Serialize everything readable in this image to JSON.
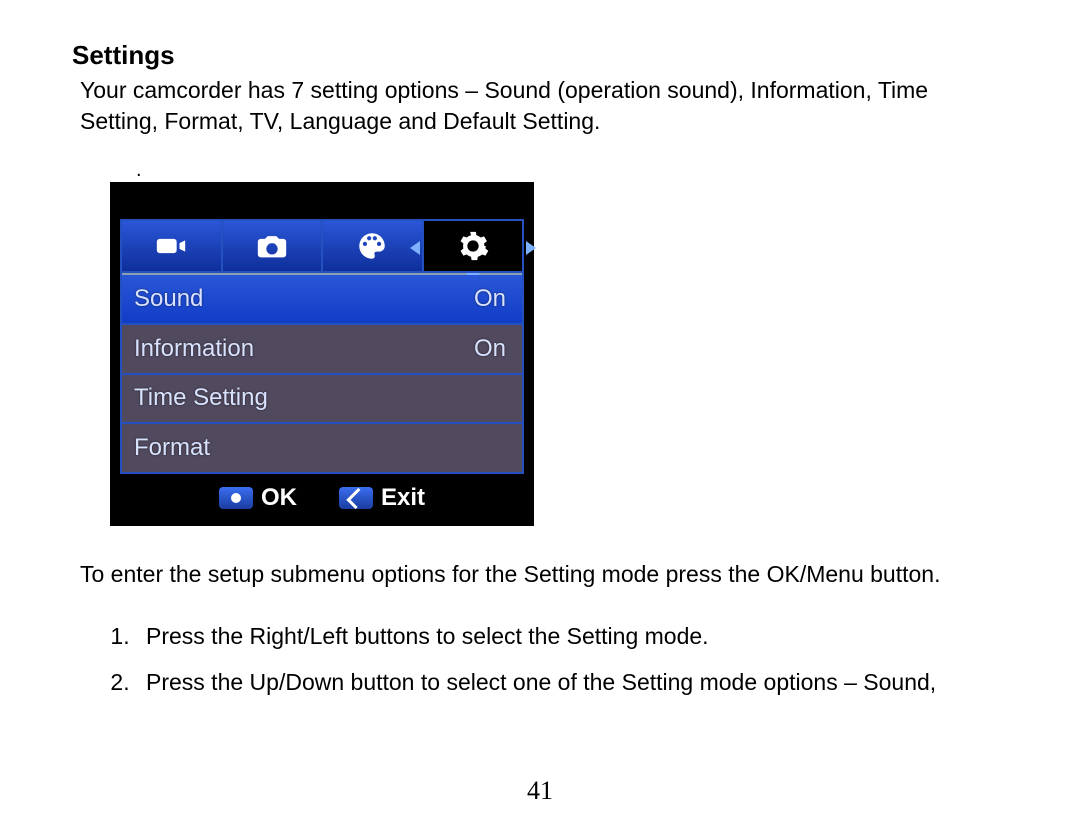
{
  "heading": "Settings",
  "intro": "Your camcorder has 7 setting options – Sound (operation sound), Information, Time Setting, Format, TV, Language and Default Setting.",
  "camera_menu": {
    "tabs": [
      "video-mode",
      "photo-mode",
      "playback-mode",
      "settings-mode"
    ],
    "selected_tab": "settings-mode",
    "items": [
      {
        "label": "Sound",
        "value": "On",
        "highlight": true
      },
      {
        "label": "Information",
        "value": "On",
        "highlight": false
      },
      {
        "label": "Time Setting",
        "value": "",
        "highlight": false
      },
      {
        "label": "Format",
        "value": "",
        "highlight": false
      }
    ],
    "footer": {
      "ok_label": "OK",
      "exit_label": "Exit"
    }
  },
  "instruction": "To enter the setup submenu options for the Setting mode press the OK/Menu button.",
  "steps": [
    "Press the Right/Left buttons to select the Setting mode.",
    "Press the Up/Down button to select one of the Setting mode options – Sound,"
  ],
  "page_number": "41"
}
